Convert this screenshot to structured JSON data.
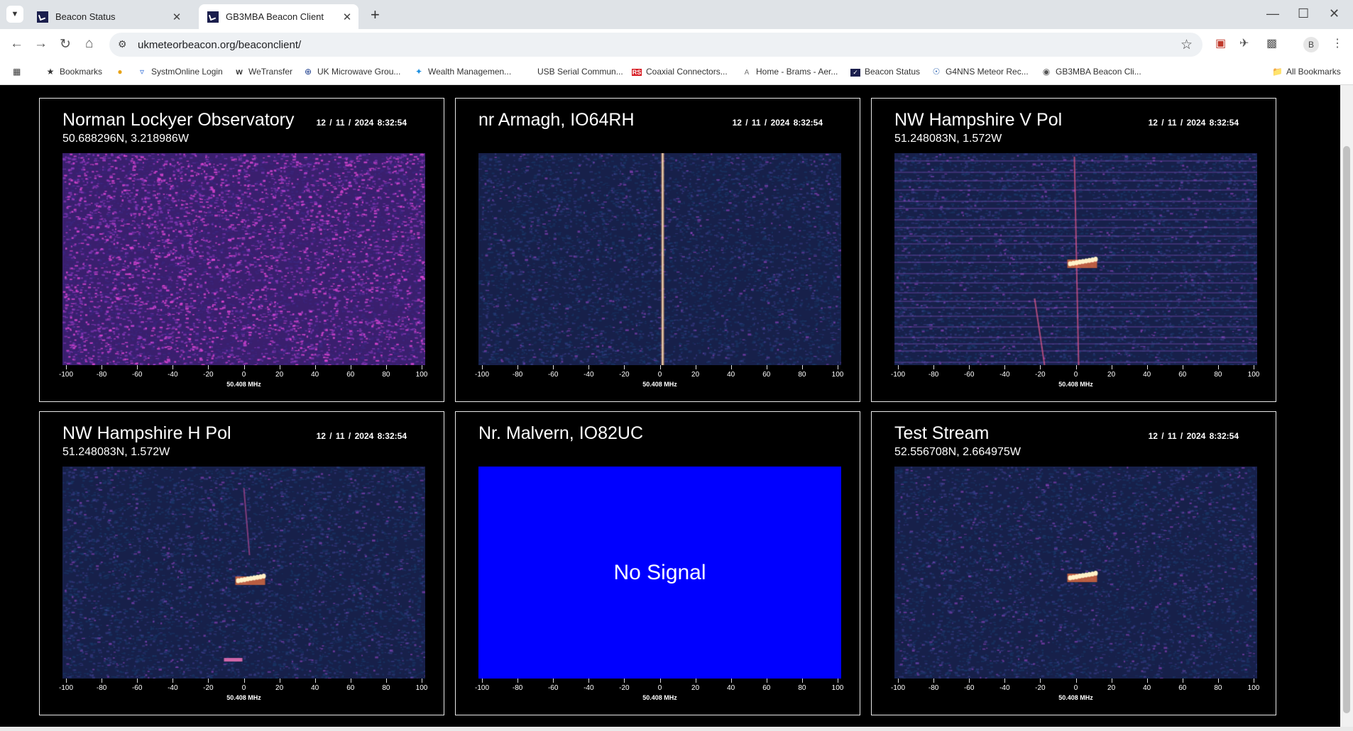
{
  "browser": {
    "tabs": [
      {
        "title": "Beacon Status",
        "active": false
      },
      {
        "title": "GB3MBA Beacon Client",
        "active": true
      }
    ],
    "url": "ukmeteorbeacon.org/beaconclient/",
    "bookmarks": [
      {
        "label": "Bookmarks",
        "icon": "star-icon"
      },
      {
        "label": "",
        "icon": "chrome-icon"
      },
      {
        "label": "SystmOnline Login",
        "icon": "systm-icon"
      },
      {
        "label": "WeTransfer",
        "icon": "wetransfer-icon"
      },
      {
        "label": "UK Microwave Grou...",
        "icon": "microwave-icon"
      },
      {
        "label": "Wealth Managemen...",
        "icon": "bank-icon"
      },
      {
        "label": "USB Serial Commun...",
        "icon": "usb-icon"
      },
      {
        "label": "Coaxial Connectors...",
        "icon": "rs-icon"
      },
      {
        "label": "Home - Brams - Aer...",
        "icon": "brams-icon"
      },
      {
        "label": "Beacon Status",
        "icon": "beacon-icon"
      },
      {
        "label": "G4NNS Meteor Rec...",
        "icon": "g4nns-icon"
      },
      {
        "label": "GB3MBA Beacon Cli...",
        "icon": "globe-icon"
      }
    ],
    "all_bookmarks": "All Bookmarks",
    "profile_initial": "B"
  },
  "axis": {
    "ticks": [
      "-100",
      "-80",
      "-60",
      "-40",
      "-20",
      "0",
      "20",
      "40",
      "60",
      "80",
      "100"
    ],
    "freq_label": "50.408 MHz"
  },
  "panels": [
    {
      "title": "Norman Lockyer Observatory",
      "coords": "50.688296N, 3.218986W",
      "date": "12 / 11 / 2024  8:32:54",
      "status": "signal",
      "pattern": "magenta-noise"
    },
    {
      "title": "nr Armagh, IO64RH",
      "coords": "",
      "date": "12 / 11 / 2024  8:32:54",
      "status": "signal",
      "pattern": "center-carrier"
    },
    {
      "title": "NW Hampshire V Pol",
      "coords": "51.248083N, 1.572W",
      "date": "12 / 11 / 2024  8:32:54",
      "status": "signal",
      "pattern": "meteor-banded"
    },
    {
      "title": "NW Hampshire H Pol",
      "coords": "51.248083N, 1.572W",
      "date": "12 / 11 / 2024  8:32:54",
      "status": "signal",
      "pattern": "meteor-low"
    },
    {
      "title": "Nr. Malvern, IO82UC",
      "coords": "",
      "date": "",
      "status": "no-signal",
      "no_signal_text": "No Signal",
      "pattern": "none"
    },
    {
      "title": "Test Stream",
      "coords": "52.556708N, 2.664975W",
      "date": "12 / 11 / 2024  8:32:54",
      "status": "signal",
      "pattern": "meteor"
    }
  ],
  "colors": {
    "no_signal_bg": "#0000ff",
    "waterfall_bg": "#17204a",
    "meteor": "#fff2c8"
  }
}
